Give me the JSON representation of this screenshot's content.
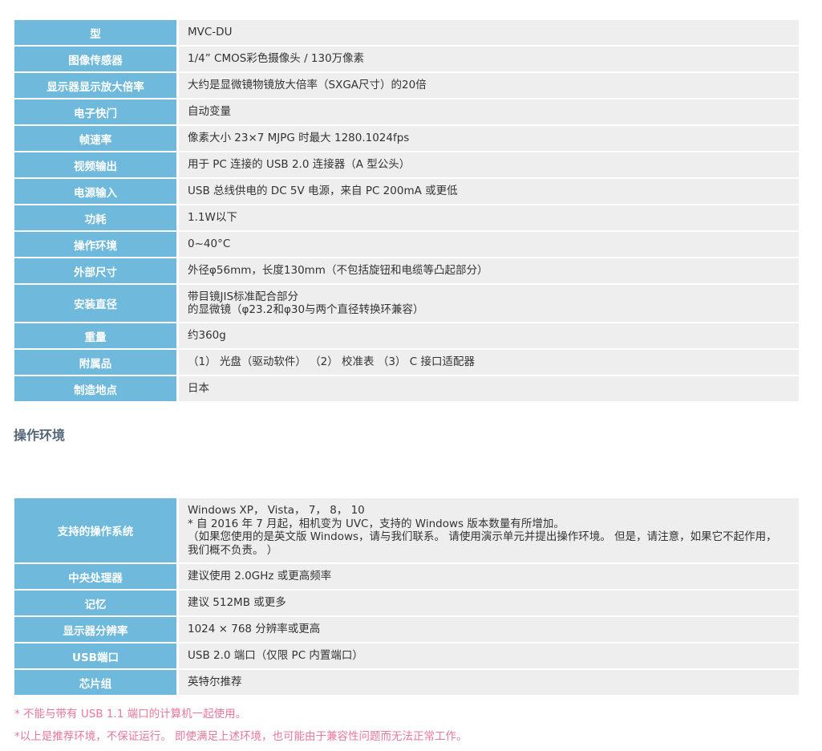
{
  "specs": [
    {
      "label": "型",
      "value": "MVC-DU"
    },
    {
      "label": "图像传感器",
      "value": "1/4” CMOS彩色摄像头 / 130万像素"
    },
    {
      "label": "显示器显示放大倍率",
      "value": "大约是显微镜物镜放大倍率（SXGA尺寸）的20倍"
    },
    {
      "label": "电子快门",
      "value": "自动变量"
    },
    {
      "label": "帧速率",
      "value": "像素大小 23×7 MJPG 时最大 1280.1024fps"
    },
    {
      "label": "视频输出",
      "value": "用于 PC 连接的 USB 2.0 连接器（A 型公头）"
    },
    {
      "label": "电源输入",
      "value": "USB 总线供电的 DC 5V 电源，来自 PC 200mA 或更低"
    },
    {
      "label": "功耗",
      "value": "1.1W以下"
    },
    {
      "label": "操作环境",
      "value": "0~40°C"
    },
    {
      "label": "外部尺寸",
      "value": "外径φ56mm，长度130mm（不包括旋钮和电缆等凸起部分）"
    },
    {
      "label": "安装直径",
      "value": "带目镜JIS标准配合部分\n的显微镜（φ23.2和φ30与两个直径转换环兼容）"
    },
    {
      "label": "重量",
      "value": "约360g"
    },
    {
      "label": "附属品",
      "value": "（1） 光盘（驱动软件） （2） 校准表 （3） C 接口适配器"
    },
    {
      "label": "制造地点",
      "value": "日本"
    }
  ],
  "section_heading": "操作环境",
  "env": [
    {
      "label": "支持的操作系统",
      "value": "Windows XP， Vista， 7， 8， 10\n* 自 2016 年 7 月起，相机变为 UVC，支持的 Windows 版本数量有所增加。\n（如果您使用的是英文版 Windows，请与我们联系。 请使用演示单元并提出操作环境。 但是，请注意，如果它不起作用，我们概不负责。 ）"
    },
    {
      "label": "中央处理器",
      "value": "建议使用 2.0GHz 或更高频率"
    },
    {
      "label": "记忆",
      "value": "建议 512MB 或更多"
    },
    {
      "label": "显示器分辨率",
      "value": "1024 × 768 分辨率或更高"
    },
    {
      "label": "USB端口",
      "value": "USB 2.0 端口（仅限 PC 内置端口）"
    },
    {
      "label": "芯片组",
      "value": "英特尔推荐"
    }
  ],
  "notes": [
    "* 不能与带有 USB 1.1 端口的计算机一起使用。",
    "*以上是推荐环境，不保证运行。 即使满足上述环境，也可能由于兼容性问题而无法正常工作。"
  ]
}
